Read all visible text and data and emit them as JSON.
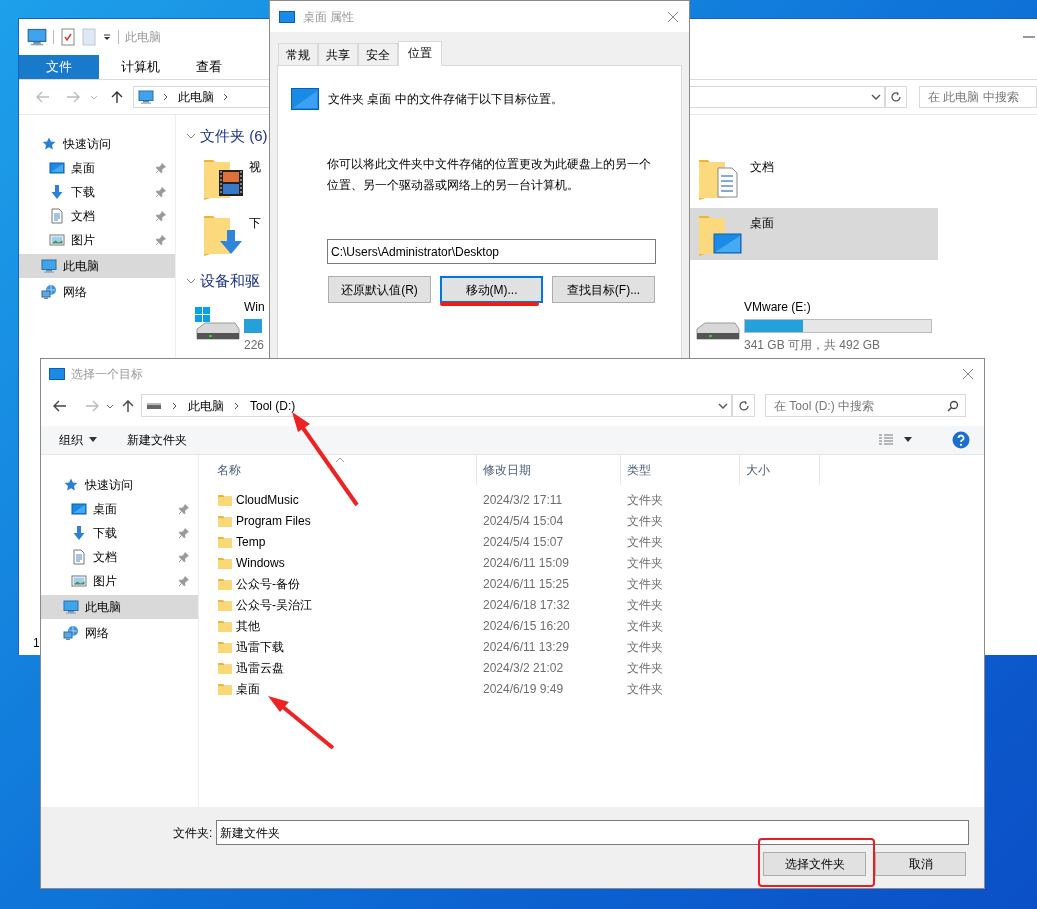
{
  "explorer": {
    "title": "此电脑",
    "ribbon_tabs": [
      {
        "label": "文件",
        "selected": true
      },
      {
        "label": "计算机",
        "selected": false
      },
      {
        "label": "查看",
        "selected": false
      }
    ],
    "breadcrumbs": [
      "此电脑"
    ],
    "search": {
      "placeholder": "在 此电脑 中搜索"
    },
    "nav": [
      {
        "label": "快速访问",
        "kind": "star",
        "pinned": false,
        "selected": false,
        "children": [
          {
            "label": "桌面",
            "kind": "desktop",
            "pinned": true,
            "selected": false
          },
          {
            "label": "下载",
            "kind": "download",
            "pinned": true,
            "selected": false
          },
          {
            "label": "文档",
            "kind": "document",
            "pinned": true,
            "selected": false
          },
          {
            "label": "图片",
            "kind": "picture",
            "pinned": true,
            "selected": false
          }
        ]
      },
      {
        "label": "此电脑",
        "kind": "computer",
        "pinned": false,
        "selected": true
      },
      {
        "label": "网络",
        "kind": "network",
        "pinned": false,
        "selected": false
      }
    ],
    "folders_header": {
      "label": "文件夹 (6)",
      "expanded": true
    },
    "folder_columns": [
      [
        {
          "name": "视",
          "kind": "video",
          "selected": false
        },
        {
          "name": "下",
          "kind": "download",
          "selected": false
        }
      ],
      [
        {
          "name": "文档",
          "kind": "document",
          "selected": false
        },
        {
          "name": "桌面",
          "kind": "desktop",
          "selected": true
        }
      ]
    ],
    "drives_header": {
      "label": "设备和驱",
      "expanded": true
    },
    "drives": [
      {
        "name": "Win",
        "kind": "system",
        "free": "226"
      },
      {
        "name": "VMware (E:)",
        "kind": "disk",
        "level": 0.31,
        "free": "341 GB 可用，共 492 GB"
      }
    ],
    "status_bar": "1"
  },
  "properties": {
    "title": "桌面 属性",
    "tabs": [
      {
        "label": "常规",
        "selected": false
      },
      {
        "label": "共享",
        "selected": false
      },
      {
        "label": "安全",
        "selected": false
      },
      {
        "label": "位置",
        "selected": true
      }
    ],
    "heading": "文件夹 桌面 中的文件存储于以下目标位置。",
    "description": "你可以将此文件夹中文件存储的位置更改为此硬盘上的另一个位置、另一个驱动器或网络上的另一台计算机。",
    "path": "C:\\Users\\Administrator\\Desktop",
    "buttons": [
      {
        "label": "还原默认值(R)",
        "focused": false
      },
      {
        "label": "移动(M)...",
        "focused": true
      },
      {
        "label": "查找目标(F)...",
        "focused": false
      }
    ]
  },
  "picker": {
    "title": "选择一个目标",
    "breadcrumbs": [
      "此电脑",
      "Tool (D:)"
    ],
    "search": {
      "placeholder": "在 Tool (D:) 中搜索"
    },
    "toolbar": [
      {
        "label": "组织",
        "dropdown": true
      },
      {
        "label": "新建文件夹",
        "dropdown": false
      }
    ],
    "nav": [
      {
        "label": "快速访问",
        "kind": "star",
        "pinned": false,
        "selected": false,
        "children": [
          {
            "label": "桌面",
            "kind": "desktop",
            "pinned": true,
            "selected": false
          },
          {
            "label": "下载",
            "kind": "download",
            "pinned": true,
            "selected": false
          },
          {
            "label": "文档",
            "kind": "document",
            "pinned": true,
            "selected": false
          },
          {
            "label": "图片",
            "kind": "picture",
            "pinned": true,
            "selected": false
          }
        ]
      },
      {
        "label": "此电脑",
        "kind": "computer",
        "pinned": false,
        "selected": true
      },
      {
        "label": "网络",
        "kind": "network",
        "pinned": false,
        "selected": false
      }
    ],
    "columns": [
      {
        "label": "名称",
        "sorted": true
      },
      {
        "label": "修改日期",
        "sorted": false
      },
      {
        "label": "类型",
        "sorted": false
      },
      {
        "label": "大小",
        "sorted": false
      }
    ],
    "rows": [
      {
        "name": "CloudMusic",
        "modified": "2024/3/2 17:11",
        "type": "文件夹"
      },
      {
        "name": "Program Files",
        "modified": "2024/5/4 15:04",
        "type": "文件夹"
      },
      {
        "name": "Temp",
        "modified": "2024/5/4 15:07",
        "type": "文件夹"
      },
      {
        "name": "Windows",
        "modified": "2024/6/11 15:09",
        "type": "文件夹"
      },
      {
        "name": "公众号-备份",
        "modified": "2024/6/11 15:25",
        "type": "文件夹"
      },
      {
        "name": "公众号-吴治江",
        "modified": "2024/6/18 17:32",
        "type": "文件夹"
      },
      {
        "name": "其他",
        "modified": "2024/6/15 16:20",
        "type": "文件夹"
      },
      {
        "name": "迅雷下载",
        "modified": "2024/6/11 13:29",
        "type": "文件夹"
      },
      {
        "name": "迅雷云盘",
        "modified": "2024/3/2 21:02",
        "type": "文件夹"
      },
      {
        "name": "桌面",
        "modified": "2024/6/19 9:49",
        "type": "文件夹"
      }
    ],
    "folder_label": "文件夹:",
    "folder_value": "新建文件夹",
    "buttons": [
      "选择文件夹",
      "取消"
    ]
  }
}
